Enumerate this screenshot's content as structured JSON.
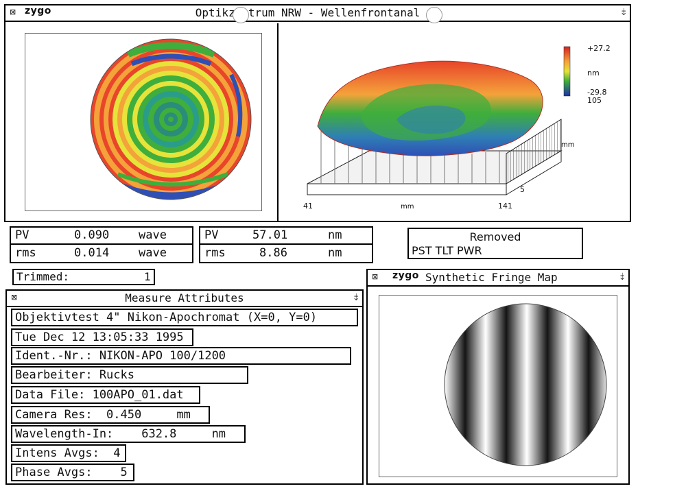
{
  "main_window": {
    "logo": "zygo",
    "title": "Optikze   trum NRW - Wellenfrontanal   se",
    "close_glyph": "⊠",
    "pin_glyph": "⤈"
  },
  "plot3d": {
    "scale_max": "+27.2",
    "scale_unit": "nm",
    "scale_min": "-29.8",
    "axis_y_max": "105",
    "axis_y_unit": "mm",
    "axis_y_min": "5",
    "axis_x_min": "41",
    "axis_x_unit": "mm",
    "axis_x_max": "141"
  },
  "stats_wave": {
    "pv_label": "PV",
    "pv_value": "0.090",
    "pv_unit": "wave",
    "rms_label": "rms",
    "rms_value": "0.014",
    "rms_unit": "wave"
  },
  "stats_nm": {
    "pv_label": "PV",
    "pv_value": "57.01",
    "pv_unit": "nm",
    "rms_label": "rms",
    "rms_value": "8.86",
    "rms_unit": "nm"
  },
  "removed": {
    "title": "Removed",
    "terms": "PST TLT PWR"
  },
  "trimmed": {
    "label": "Trimmed:",
    "value": "1"
  },
  "attributes_window": {
    "title": "Measure Attributes",
    "close_glyph": "⊠",
    "pin_glyph": "⤈",
    "fields": [
      "Objektivtest 4\" Nikon-Apochromat (X=0, Y=0)",
      "Tue Dec 12 13:05:33 1995",
      "Ident.-Nr.: NIKON-APO 100/1200",
      "Bearbeiter: Rucks",
      "Data File: 100APO_01.dat",
      "Camera Res:  0.450     mm",
      "Wavelength-In:    632.8     nm",
      "Intens Avgs:  4",
      "Phase Avgs:    5"
    ]
  },
  "fringe_window": {
    "logo": "zygo",
    "title": "Synthetic Fringe Map",
    "close_glyph": "⊠",
    "pin_glyph": "⤈"
  },
  "colors": {
    "frame": "#000000",
    "background": "#ffffff",
    "map_red": "#e8452a",
    "map_orange": "#f4a23a",
    "map_yellow": "#e6e33a",
    "map_green": "#3fae3c",
    "map_blue": "#2f4fb5"
  }
}
